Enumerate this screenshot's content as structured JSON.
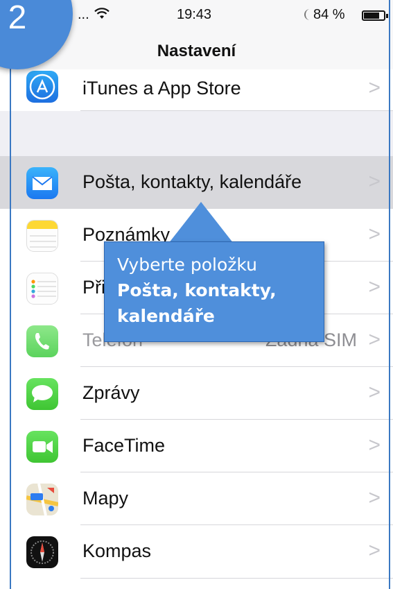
{
  "badge": {
    "number": "2"
  },
  "status_bar": {
    "signal": "...",
    "time": "19:43",
    "battery": "84 %",
    "battery_level": 0.84
  },
  "nav": {
    "title": "Nastavení"
  },
  "rows": [
    {
      "label": "iTunes a App Store",
      "icon": "app-store-icon"
    },
    {
      "label": "Pošta, kontakty, kalendáře",
      "icon": "mail-icon",
      "selected": true
    },
    {
      "label": "Poznámky",
      "icon": "notes-icon"
    },
    {
      "label": "Připomínky",
      "icon": "reminders-icon"
    },
    {
      "label": "Telefon",
      "detail": "Žádná SIM",
      "icon": "phone-icon"
    },
    {
      "label": "Zprávy",
      "icon": "messages-icon"
    },
    {
      "label": "FaceTime",
      "icon": "facetime-icon"
    },
    {
      "label": "Mapy",
      "icon": "maps-icon"
    },
    {
      "label": "Kompas",
      "icon": "compass-icon"
    }
  ],
  "callout": {
    "line1": "Vyberte položku",
    "bold_line": "Pošta, kontakty, kalendáře"
  },
  "colors": {
    "accent": "#4f8fdb",
    "ios_bg": "#efeff4",
    "selected_row": "#d8d8dc"
  }
}
